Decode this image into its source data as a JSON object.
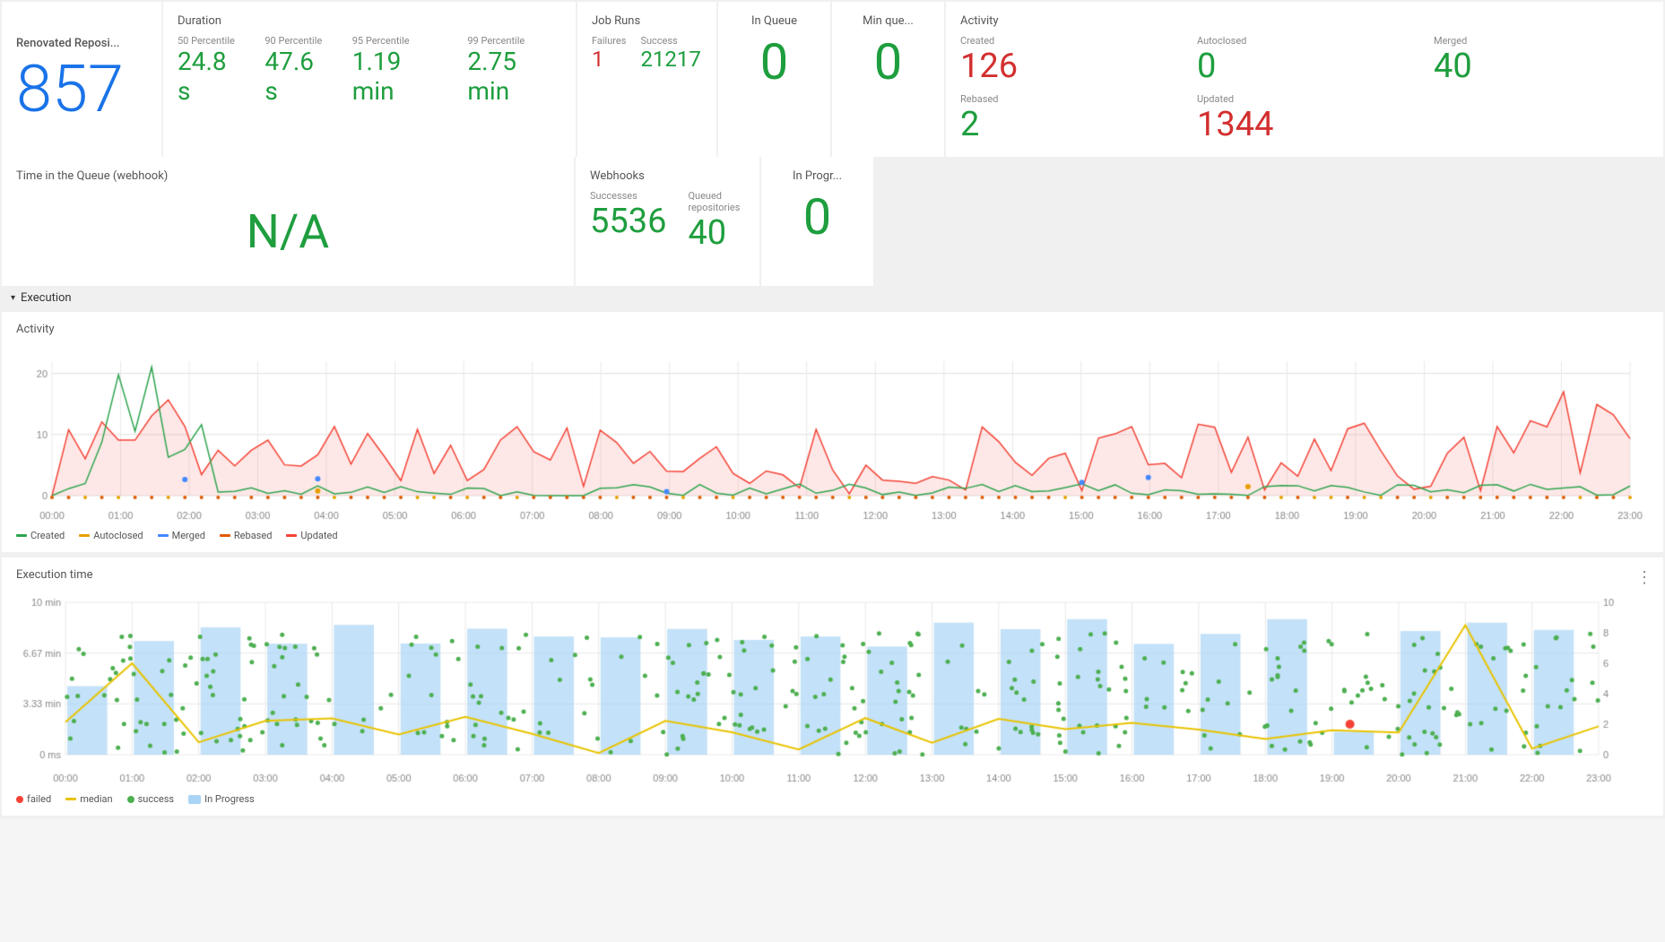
{
  "repo": {
    "name": "Renovated Reposi...",
    "count": "857"
  },
  "duration": {
    "title": "Duration",
    "p50_label": "50 Percentile",
    "p50_value": "24.8 s",
    "p90_label": "90 Percentile",
    "p90_value": "47.6 s",
    "p95_label": "95 Percentile",
    "p95_value": "1.19 min",
    "p99_label": "99 Percentile",
    "p99_value": "2.75 min"
  },
  "time_queue": {
    "title": "Time in the Queue (webhook)",
    "value": "N/A"
  },
  "job_runs": {
    "title": "Job Runs",
    "failures_label": "Failures",
    "failures_value": "1",
    "success_label": "Success",
    "success_value": "21217"
  },
  "in_queue": {
    "title": "In Queue",
    "value": "0"
  },
  "min_que": {
    "title": "Min que...",
    "value": "0"
  },
  "activity": {
    "title": "Activity",
    "created_label": "Created",
    "created_value": "126",
    "autoclosed_label": "Autoclosed",
    "autoclosed_value": "0",
    "merged_label": "Merged",
    "merged_value": "40",
    "rebased_label": "Rebased",
    "rebased_value": "2",
    "updated_label": "Updated",
    "updated_value": "1344"
  },
  "webhooks": {
    "title": "Webhooks",
    "successes_label": "Successes",
    "successes_value": "5536",
    "queued_label": "Queued repositories",
    "queued_value": "40"
  },
  "in_progress": {
    "title": "In Progr...",
    "value": "0"
  },
  "execution": {
    "label": "Execution"
  },
  "activity_chart": {
    "title": "Activity",
    "legend": [
      {
        "label": "Created",
        "color": "#2ea44f"
      },
      {
        "label": "Autoclosed",
        "color": "#e8a000"
      },
      {
        "label": "Merged",
        "color": "#4488ff"
      },
      {
        "label": "Rebased",
        "color": "#e05a00"
      },
      {
        "label": "Updated",
        "color": "#f44336"
      }
    ]
  },
  "execution_time_chart": {
    "title": "Execution time",
    "legend": [
      {
        "label": "failed",
        "color": "#f44336"
      },
      {
        "label": "median",
        "color": "#e8c300"
      },
      {
        "label": "success",
        "color": "#4caf50"
      },
      {
        "label": "In Progress",
        "color": "#aad4f5"
      }
    ]
  },
  "time_labels": [
    "00:00",
    "01:00",
    "02:00",
    "03:00",
    "04:00",
    "05:00",
    "06:00",
    "07:00",
    "08:00",
    "09:00",
    "10:00",
    "11:00",
    "12:00",
    "13:00",
    "14:00",
    "15:00",
    "16:00",
    "17:00",
    "18:00",
    "19:00",
    "20:00",
    "21:00",
    "22:00",
    "23:00"
  ]
}
